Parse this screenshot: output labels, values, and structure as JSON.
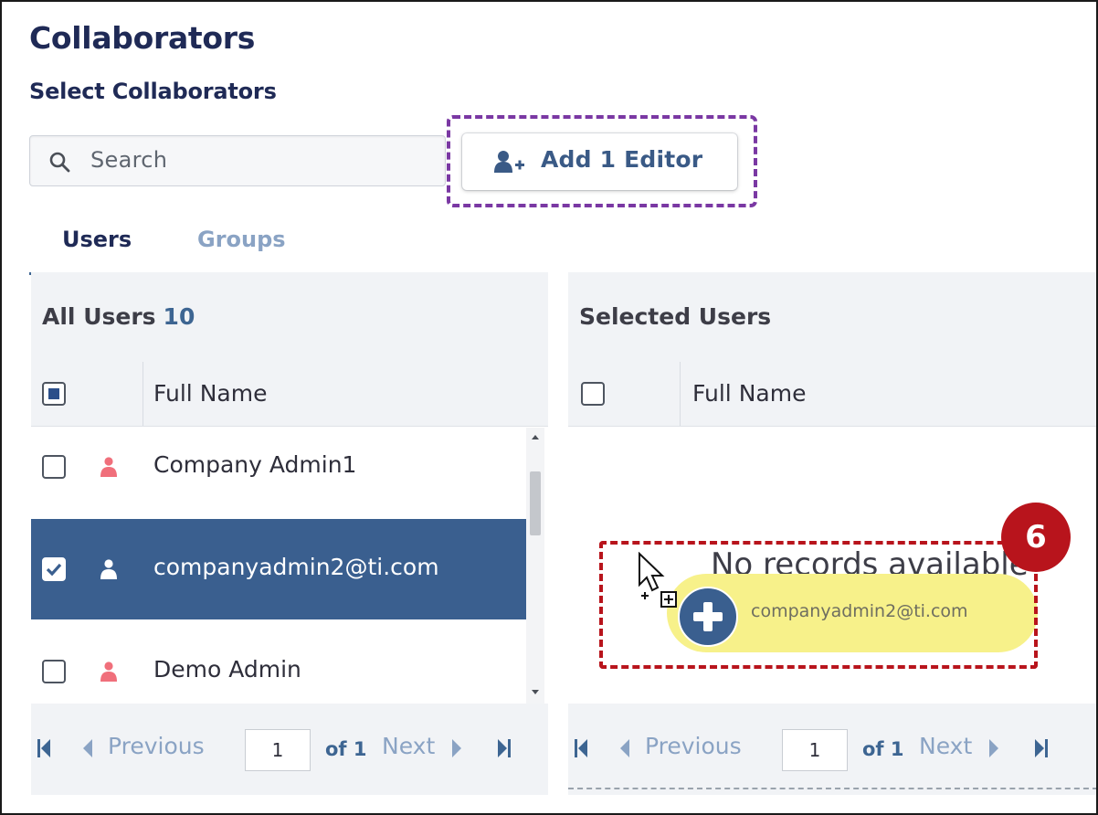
{
  "header": {
    "title": "Collaborators",
    "subtitle": "Select Collaborators"
  },
  "search": {
    "placeholder": "Search"
  },
  "add_button": {
    "label": "Add 1 Editor"
  },
  "tabs": [
    {
      "label": "Users",
      "active": true
    },
    {
      "label": "Groups",
      "active": false
    }
  ],
  "all_users": {
    "title": "All Users",
    "count": "10",
    "column": "Full Name",
    "rows": [
      {
        "name": "Company Admin1",
        "checked": false,
        "icon": "user-icon"
      },
      {
        "name": "companyadmin2@ti.com",
        "checked": true,
        "icon": "user-icon"
      },
      {
        "name": "Demo Admin",
        "checked": false,
        "icon": "user-icon"
      }
    ],
    "pager": {
      "previous": "Previous",
      "page": "1",
      "of": "of 1",
      "next": "Next"
    }
  },
  "selected_users": {
    "title": "Selected Users",
    "column": "Full Name",
    "empty_text": "No records available",
    "pager": {
      "previous": "Previous",
      "page": "1",
      "of": "of 1",
      "next": "Next"
    }
  },
  "drag": {
    "label": "companyadmin2@ti.com"
  },
  "callout": {
    "number": "6"
  },
  "colors": {
    "accent": "#3a5f8f",
    "drag_pill": "#f7f18a",
    "callout": "#b8141c",
    "highlight_box": "#7a38a3"
  }
}
